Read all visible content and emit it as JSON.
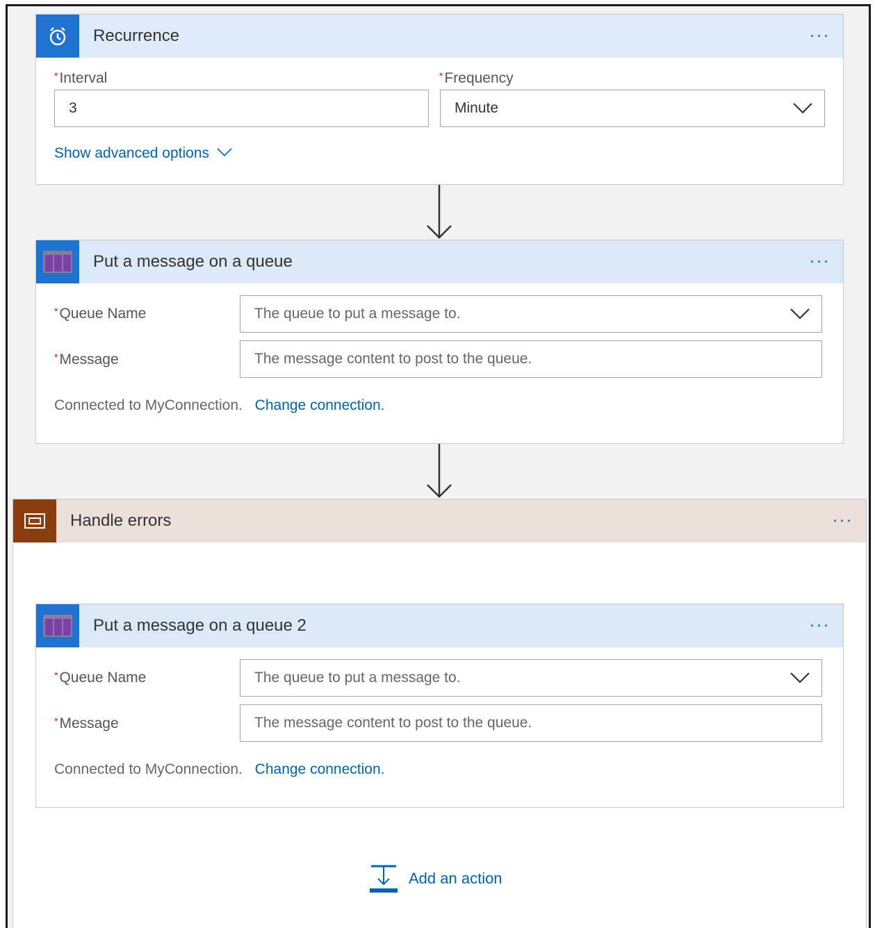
{
  "recurrence": {
    "title": "Recurrence",
    "more": "...",
    "interval_label": "Interval",
    "interval_value": "3",
    "frequency_label": "Frequency",
    "frequency_value": "Minute",
    "advanced_link": "Show advanced options",
    "icon": "alarm-clock-icon",
    "accent": "#1e73d1"
  },
  "queue1": {
    "title": "Put a message on a queue",
    "more": "...",
    "queue_name_label": "Queue Name",
    "queue_name_placeholder": "The queue to put a message to.",
    "message_label": "Message",
    "message_placeholder": "The message content to post to the queue.",
    "connected_text": "Connected to MyConnection.",
    "change_link": "Change connection.",
    "icon": "storage-queue-icon"
  },
  "scope": {
    "title": "Handle errors",
    "more": "...",
    "icon": "scope-icon",
    "accent": "#8c3d0e"
  },
  "queue2": {
    "title": "Put a message on a queue 2",
    "more": "...",
    "queue_name_label": "Queue Name",
    "queue_name_placeholder": "The queue to put a message to.",
    "message_label": "Message",
    "message_placeholder": "The message content to post to the queue.",
    "connected_text": "Connected to MyConnection.",
    "change_link": "Change connection.",
    "icon": "storage-queue-icon"
  },
  "add_action": {
    "label": "Add an action",
    "icon": "add-action-icon"
  },
  "colors": {
    "link": "#0063b1",
    "required": "#e81123"
  }
}
